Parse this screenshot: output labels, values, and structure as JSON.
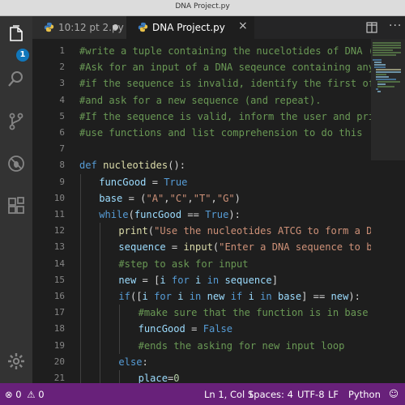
{
  "window": {
    "title": "DNA Project.py"
  },
  "activity_bar": {
    "explorer_badge": "1"
  },
  "tabs": [
    {
      "label": "10:12 pt 2.py",
      "dirty": true,
      "active": false
    },
    {
      "label": "DNA Project.py",
      "dirty": false,
      "active": true
    }
  ],
  "editor": {
    "language": "Python",
    "line_numbers": [
      "1",
      "2",
      "3",
      "4",
      "5",
      "6",
      "7",
      "8",
      "9",
      "10",
      "11",
      "12",
      "13",
      "14",
      "15",
      "16",
      "17",
      "18",
      "19",
      "20",
      "21"
    ],
    "lines": [
      {
        "indent": 0,
        "tokens": [
          {
            "t": "#write a tuple containing the nucelotides of DNA (A,C,T,G).",
            "c": "comment"
          }
        ]
      },
      {
        "indent": 0,
        "tokens": [
          {
            "t": "#Ask for an input of a DNA seqeunce containing any number o",
            "c": "comment"
          }
        ]
      },
      {
        "indent": 0,
        "tokens": [
          {
            "t": "#if the sequence is invalid, identify the first offending c",
            "c": "comment"
          }
        ]
      },
      {
        "indent": 0,
        "tokens": [
          {
            "t": "#and ask for a new sequence (and repeat).",
            "c": "comment"
          }
        ]
      },
      {
        "indent": 0,
        "tokens": [
          {
            "t": "#If the sequence is valid, inform the user and print the co",
            "c": "comment"
          }
        ]
      },
      {
        "indent": 0,
        "tokens": [
          {
            "t": "#use functions and list comprehension to do this",
            "c": "comment"
          }
        ]
      },
      {
        "indent": 0,
        "tokens": []
      },
      {
        "indent": 0,
        "tokens": [
          {
            "t": "def ",
            "c": "keyword"
          },
          {
            "t": "nucleotides",
            "c": "function"
          },
          {
            "t": "():",
            "c": "plain"
          }
        ]
      },
      {
        "indent": 1,
        "tokens": [
          {
            "t": "funcGood",
            "c": "variable"
          },
          {
            "t": " = ",
            "c": "plain"
          },
          {
            "t": "True",
            "c": "constant"
          }
        ]
      },
      {
        "indent": 1,
        "tokens": [
          {
            "t": "base",
            "c": "variable"
          },
          {
            "t": " = (",
            "c": "plain"
          },
          {
            "t": "\"A\"",
            "c": "string"
          },
          {
            "t": ",",
            "c": "plain"
          },
          {
            "t": "\"C\"",
            "c": "string"
          },
          {
            "t": ",",
            "c": "plain"
          },
          {
            "t": "\"T\"",
            "c": "string"
          },
          {
            "t": ",",
            "c": "plain"
          },
          {
            "t": "\"G\"",
            "c": "string"
          },
          {
            "t": ")",
            "c": "plain"
          }
        ]
      },
      {
        "indent": 1,
        "tokens": [
          {
            "t": "while",
            "c": "keyword"
          },
          {
            "t": "(",
            "c": "plain"
          },
          {
            "t": "funcGood",
            "c": "variable"
          },
          {
            "t": " == ",
            "c": "plain"
          },
          {
            "t": "True",
            "c": "constant"
          },
          {
            "t": "):",
            "c": "plain"
          }
        ]
      },
      {
        "indent": 2,
        "tokens": [
          {
            "t": "print",
            "c": "function"
          },
          {
            "t": "(",
            "c": "plain"
          },
          {
            "t": "\"Use the nucleotides ATCG to form a DNA sequen",
            "c": "string"
          }
        ]
      },
      {
        "indent": 2,
        "tokens": [
          {
            "t": "sequence",
            "c": "variable"
          },
          {
            "t": " = ",
            "c": "plain"
          },
          {
            "t": "input",
            "c": "function"
          },
          {
            "t": "(",
            "c": "plain"
          },
          {
            "t": "\"Enter a DNA sequence to be matche",
            "c": "string"
          }
        ]
      },
      {
        "indent": 2,
        "tokens": [
          {
            "t": "#step to ask for input",
            "c": "comment"
          }
        ]
      },
      {
        "indent": 2,
        "tokens": [
          {
            "t": "new",
            "c": "variable"
          },
          {
            "t": " = [",
            "c": "plain"
          },
          {
            "t": "i",
            "c": "variable"
          },
          {
            "t": " ",
            "c": "plain"
          },
          {
            "t": "for",
            "c": "keyword"
          },
          {
            "t": " ",
            "c": "plain"
          },
          {
            "t": "i",
            "c": "variable"
          },
          {
            "t": " ",
            "c": "plain"
          },
          {
            "t": "in",
            "c": "keyword"
          },
          {
            "t": " ",
            "c": "plain"
          },
          {
            "t": "sequence",
            "c": "variable"
          },
          {
            "t": "]",
            "c": "plain"
          }
        ]
      },
      {
        "indent": 2,
        "tokens": [
          {
            "t": "if",
            "c": "keyword"
          },
          {
            "t": "([",
            "c": "plain"
          },
          {
            "t": "i",
            "c": "variable"
          },
          {
            "t": " ",
            "c": "plain"
          },
          {
            "t": "for",
            "c": "keyword"
          },
          {
            "t": " ",
            "c": "plain"
          },
          {
            "t": "i",
            "c": "variable"
          },
          {
            "t": " ",
            "c": "plain"
          },
          {
            "t": "in",
            "c": "keyword"
          },
          {
            "t": " ",
            "c": "plain"
          },
          {
            "t": "new",
            "c": "variable"
          },
          {
            "t": " ",
            "c": "plain"
          },
          {
            "t": "if",
            "c": "keyword"
          },
          {
            "t": " ",
            "c": "plain"
          },
          {
            "t": "i",
            "c": "variable"
          },
          {
            "t": " ",
            "c": "plain"
          },
          {
            "t": "in",
            "c": "keyword"
          },
          {
            "t": " ",
            "c": "plain"
          },
          {
            "t": "base",
            "c": "variable"
          },
          {
            "t": "] == ",
            "c": "plain"
          },
          {
            "t": "new",
            "c": "variable"
          },
          {
            "t": "):",
            "c": "plain"
          }
        ]
      },
      {
        "indent": 3,
        "tokens": [
          {
            "t": "#make sure that the function is in base and val",
            "c": "comment"
          }
        ]
      },
      {
        "indent": 3,
        "tokens": [
          {
            "t": "funcGood",
            "c": "variable"
          },
          {
            "t": " = ",
            "c": "plain"
          },
          {
            "t": "False",
            "c": "constant"
          }
        ]
      },
      {
        "indent": 3,
        "tokens": [
          {
            "t": "#ends the asking for new input loop",
            "c": "comment"
          }
        ]
      },
      {
        "indent": 2,
        "tokens": [
          {
            "t": "else",
            "c": "keyword"
          },
          {
            "t": ":",
            "c": "plain"
          }
        ]
      },
      {
        "indent": 3,
        "tokens": [
          {
            "t": "place",
            "c": "variable"
          },
          {
            "t": "=",
            "c": "plain"
          },
          {
            "t": "0",
            "c": "number"
          }
        ]
      }
    ]
  },
  "status_bar": {
    "errors": "0",
    "warnings": "0",
    "cursor": "Ln 1, Col 1",
    "indentation": "Spaces: 4",
    "encoding": "UTF-8",
    "eol": "LF",
    "language": "Python"
  },
  "colors": {
    "status_bar": "#68217a",
    "badge": "#1177bb",
    "comment": "#6a9955",
    "keyword": "#569cd6",
    "string": "#ce9178",
    "function": "#dcdcaa",
    "variable": "#9cdcfe"
  }
}
